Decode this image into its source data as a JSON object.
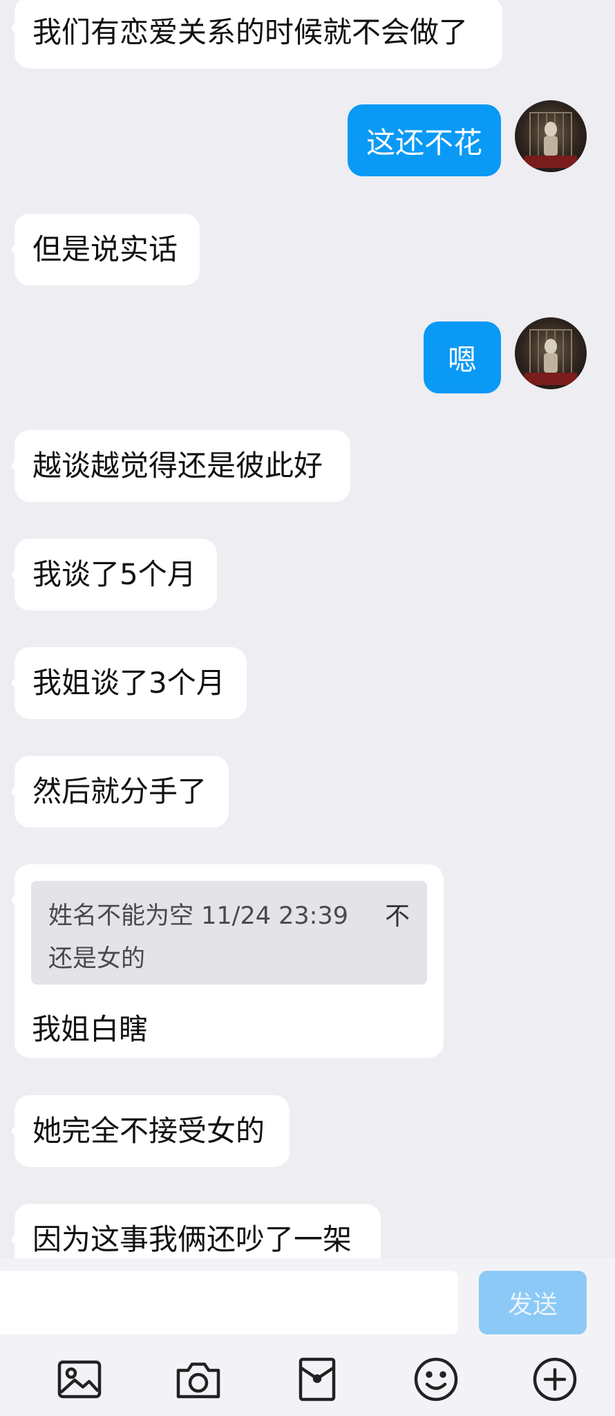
{
  "messages": {
    "m1": "我们有恋爱关系的时候就不会做了",
    "m2": "这还不花",
    "m3": "但是说实话",
    "m4": "嗯",
    "m5": "越谈越觉得还是彼此好",
    "m6": "我谈了5个月",
    "m7": "我姐谈了3个月",
    "m8": "然后就分手了",
    "m9": "我姐白瞎",
    "m10": "她完全不接受女的",
    "m11": "因为这事我俩还吵了一架"
  },
  "quote": {
    "meta": "姓名不能为空 11/24 23:39",
    "text": "还是女的",
    "arrow": "不"
  },
  "input": {
    "placeholder": "",
    "send_label": "发送"
  },
  "toolbar": {
    "icons": [
      "image-icon",
      "camera-icon",
      "red-packet-icon",
      "emoji-icon",
      "plus-icon"
    ]
  },
  "colors": {
    "background": "#ededf2",
    "outgoing_bubble": "#0a99f5",
    "send_button_disabled": "#8cc9f6"
  }
}
